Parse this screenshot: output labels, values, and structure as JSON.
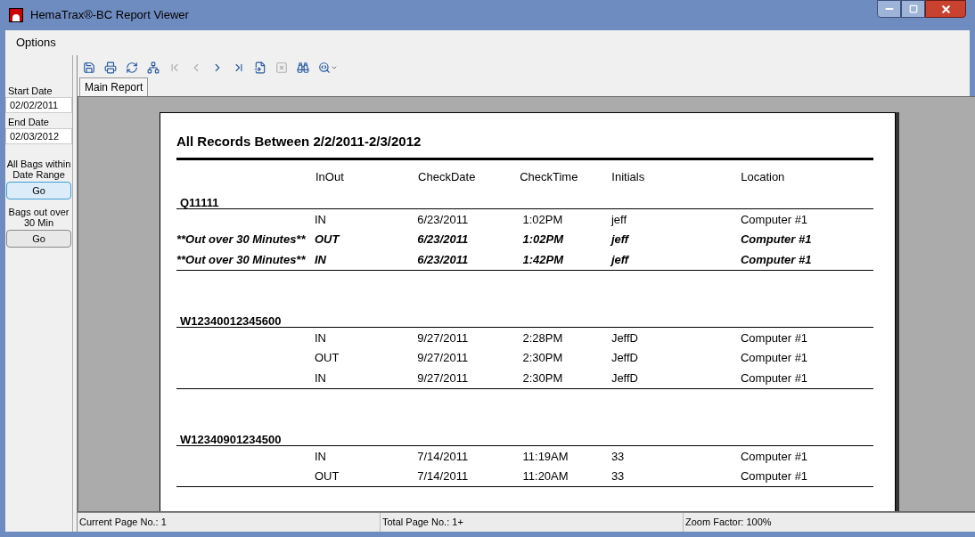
{
  "window": {
    "title": "HemaTrax®-BC Report Viewer"
  },
  "menu": [
    "Options"
  ],
  "sidebar": {
    "start_label": "Start Date",
    "start_value": "02/02/2011",
    "end_label": "End Date",
    "end_value": "02/03/2012",
    "actions": [
      {
        "label": "All Bags within Date Range",
        "button": "Go",
        "focused": true
      },
      {
        "label": "Bags out over 30 Min",
        "button": "Go",
        "focused": false
      }
    ]
  },
  "toolbar": [
    {
      "kind": "export",
      "disabled": false
    },
    {
      "kind": "print",
      "disabled": false
    },
    {
      "kind": "refresh",
      "disabled": false
    },
    {
      "kind": "tree",
      "disabled": false
    },
    {
      "kind": "first",
      "disabled": true
    },
    {
      "kind": "prev",
      "disabled": true
    },
    {
      "kind": "next",
      "disabled": false
    },
    {
      "kind": "last",
      "disabled": false
    },
    {
      "kind": "goto",
      "disabled": false
    },
    {
      "kind": "stop",
      "disabled": true
    },
    {
      "kind": "find",
      "disabled": false
    },
    {
      "kind": "zoom",
      "disabled": false
    }
  ],
  "tabs": [
    {
      "label": "Main Report",
      "selected": true
    }
  ],
  "report": {
    "title": "All Records Between 2/2/2011-2/3/2012",
    "columns": [
      "InOut",
      "CheckDate",
      "CheckTime",
      "Initials",
      "Location"
    ],
    "groups": [
      {
        "bag": "Q11111",
        "rows": [
          {
            "note": "",
            "cells": [
              "IN",
              "6/23/2011",
              "1:02PM",
              "jeff",
              "Computer #1"
            ],
            "flagged": false
          },
          {
            "note": "**Out over 30 Minutes**",
            "cells": [
              "OUT",
              "6/23/2011",
              "1:02PM",
              "jeff",
              "Computer #1"
            ],
            "flagged": true
          },
          {
            "note": "**Out over 30 Minutes**",
            "cells": [
              "IN",
              "6/23/2011",
              "1:42PM",
              "jeff",
              "Computer #1"
            ],
            "flagged": true
          }
        ]
      },
      {
        "bag": "W12340012345600",
        "rows": [
          {
            "note": "",
            "cells": [
              "IN",
              "9/27/2011",
              "2:28PM",
              "JeffD",
              "Computer #1"
            ],
            "flagged": false
          },
          {
            "note": "",
            "cells": [
              "OUT",
              "9/27/2011",
              "2:30PM",
              "JeffD",
              "Computer #1"
            ],
            "flagged": false
          },
          {
            "note": "",
            "cells": [
              "IN",
              "9/27/2011",
              "2:30PM",
              "JeffD",
              "Computer #1"
            ],
            "flagged": false
          }
        ]
      },
      {
        "bag": "W12340901234500",
        "rows": [
          {
            "note": "",
            "cells": [
              "IN",
              "7/14/2011",
              "11:19AM",
              "33",
              "Computer #1"
            ],
            "flagged": false
          },
          {
            "note": "",
            "cells": [
              "OUT",
              "7/14/2011",
              "11:20AM",
              "33",
              "Computer #1"
            ],
            "flagged": false
          }
        ]
      }
    ]
  },
  "status_bar": [
    "Current Page No.: 1",
    "Total Page No.: 1+",
    "Zoom Factor: 100%"
  ]
}
